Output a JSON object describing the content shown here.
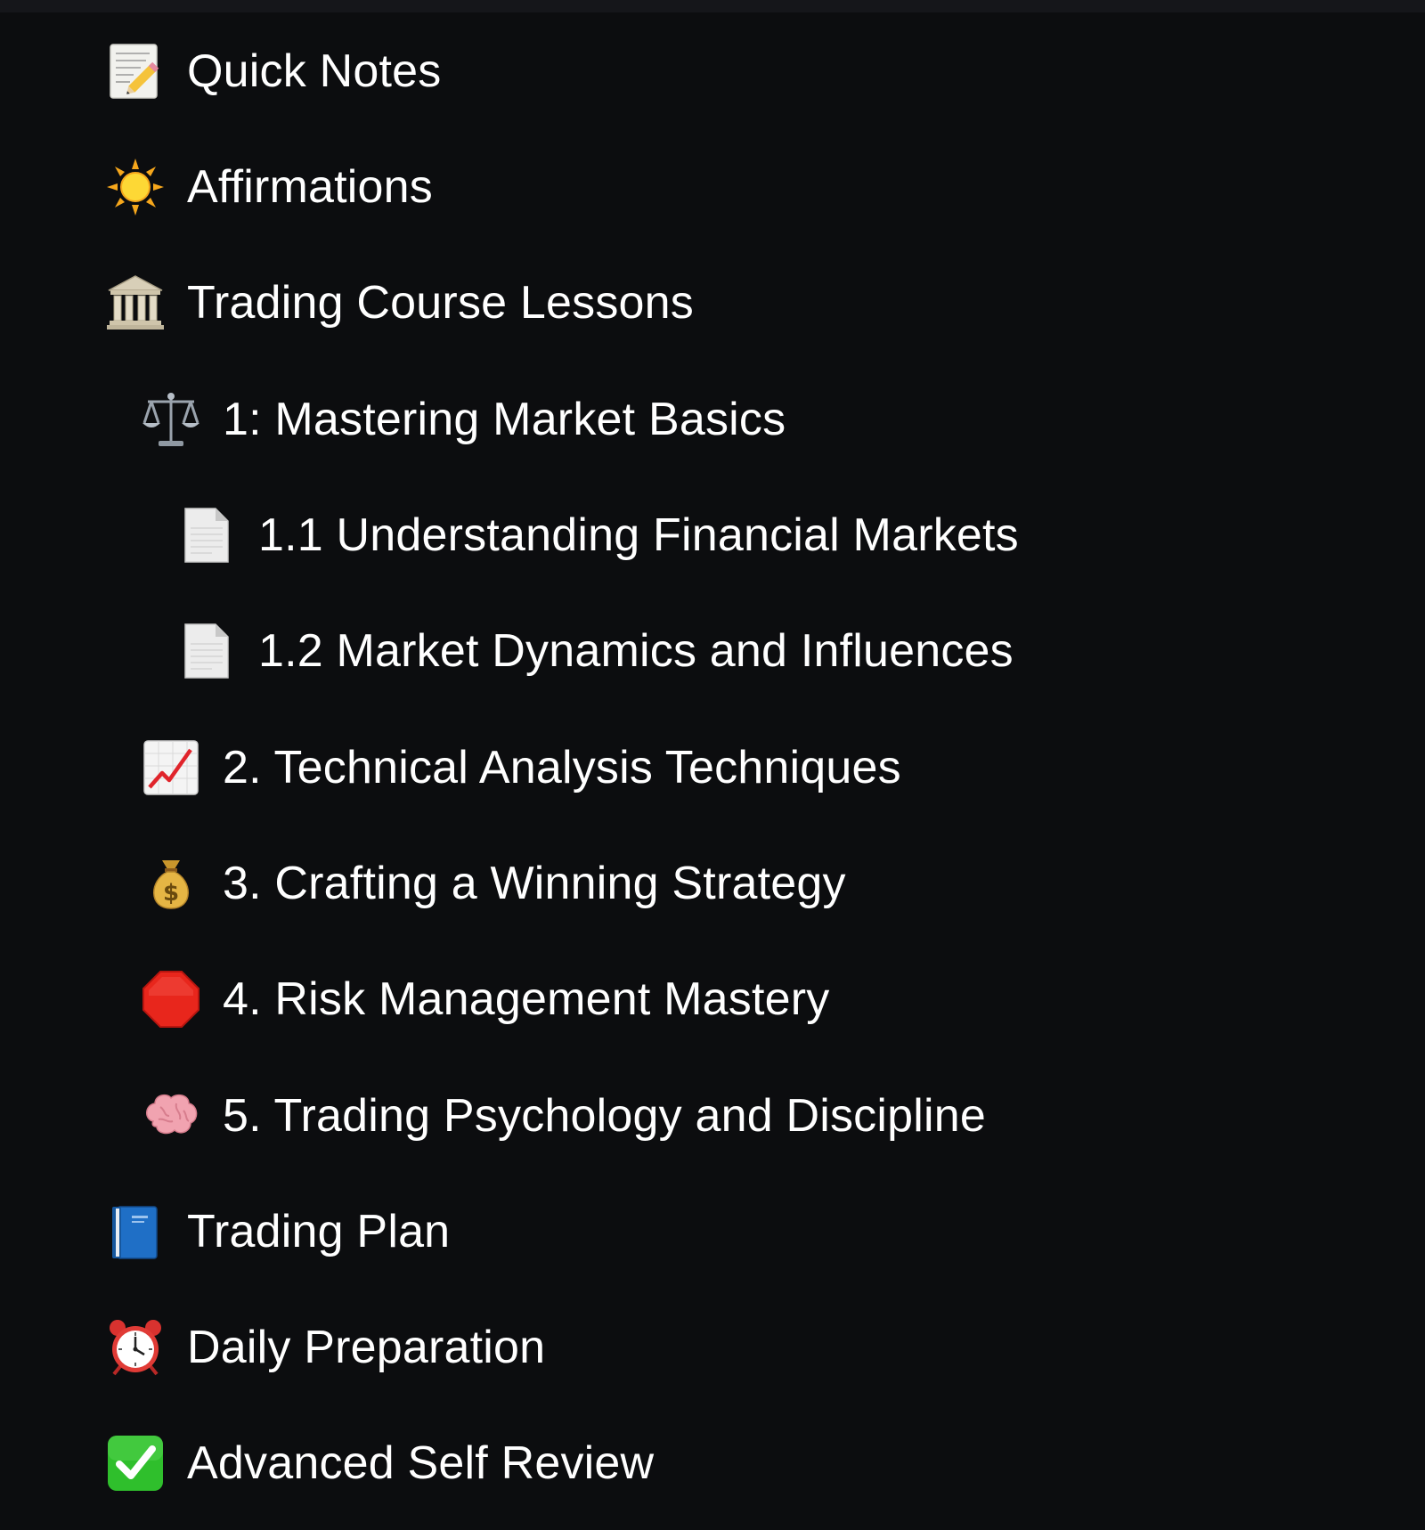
{
  "nav": {
    "items": [
      {
        "label": "Quick Notes",
        "icon": "memo-icon",
        "level": 0
      },
      {
        "label": "Affirmations",
        "icon": "sun-icon",
        "level": 0
      },
      {
        "label": "Trading Course Lessons",
        "icon": "classical-building-icon",
        "level": 0
      },
      {
        "label": "1: Mastering Market Basics",
        "icon": "balance-scale-icon",
        "level": 1
      },
      {
        "label": "1.1 Understanding Financial Markets",
        "icon": "page-icon",
        "level": 2
      },
      {
        "label": "1.2 Market Dynamics and Influences",
        "icon": "page-icon",
        "level": 2
      },
      {
        "label": "2. Technical Analysis Techniques",
        "icon": "chart-increasing-icon",
        "level": 1
      },
      {
        "label": "3. Crafting a Winning Strategy",
        "icon": "money-bag-icon",
        "level": 1
      },
      {
        "label": "4. Risk Management Mastery",
        "icon": "stop-sign-icon",
        "level": 1
      },
      {
        "label": "5. Trading Psychology and Discipline",
        "icon": "brain-icon",
        "level": 1
      },
      {
        "label": "Trading Plan",
        "icon": "blue-book-icon",
        "level": 0
      },
      {
        "label": "Daily Preparation",
        "icon": "alarm-clock-icon",
        "level": 0
      },
      {
        "label": "Advanced Self Review",
        "icon": "check-mark-button-icon",
        "level": 0
      }
    ]
  },
  "colors": {
    "background": "#0c0d0f",
    "text": "#ffffff"
  }
}
